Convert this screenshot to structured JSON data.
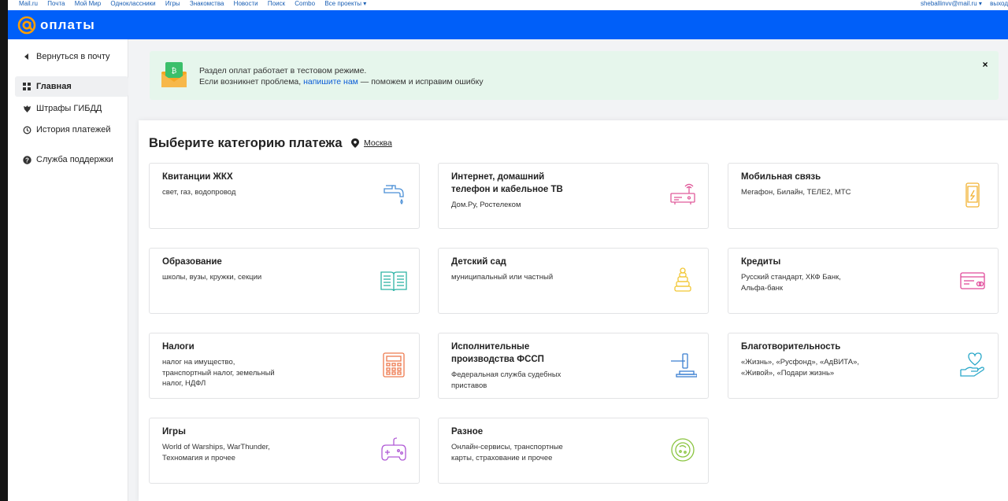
{
  "topbar": {
    "links": [
      "Mail.ru",
      "Почта",
      "Мой Мир",
      "Одноклассники",
      "Игры",
      "Знакомства",
      "Новости",
      "Поиск",
      "Combo",
      "Все проекты ▾"
    ],
    "user": "sheballinvv@mail.ru ▾",
    "logout": "выход"
  },
  "header": {
    "logo_text": "оплаты"
  },
  "sidebar": {
    "items": [
      {
        "label": "Вернуться в почту",
        "icon": "back-arrow-icon"
      },
      {
        "label": "Главная",
        "icon": "grid-icon"
      },
      {
        "label": "Штрафы ГИБДД",
        "icon": "emblem-icon"
      },
      {
        "label": "История платежей",
        "icon": "history-icon"
      },
      {
        "label": "Служба поддержки",
        "icon": "help-icon"
      }
    ]
  },
  "banner": {
    "line1": "Раздел оплат работает в тестовом режиме.",
    "line2_prefix": "Если возникнет проблема, ",
    "line2_link": "напишите нам",
    "line2_suffix": " — поможем и исправим ошибку",
    "close": "×"
  },
  "main": {
    "title": "Выберите категорию платежа",
    "city": "Москва"
  },
  "categories": [
    {
      "title": "Квитанции ЖКХ",
      "subtitle": "свет, газ, водопровод",
      "icon": "faucet-icon",
      "color": "#4a8fd6"
    },
    {
      "title": "Интернет, домашний телефон и кабельное ТВ",
      "subtitle": "Дом.Ру, Ростелеком",
      "icon": "router-icon",
      "color": "#e05a9a"
    },
    {
      "title": "Мобильная связь",
      "subtitle": "Мегафон, Билайн, ТЕЛЕ2, МТС",
      "icon": "phone-icon",
      "color": "#f2b233"
    },
    {
      "title": "Образование",
      "subtitle": "школы, вузы, кружки, секции",
      "icon": "book-icon",
      "color": "#2cb3a5"
    },
    {
      "title": "Детский сад",
      "subtitle": "муниципальный или частный",
      "icon": "pyramid-toy-icon",
      "color": "#f2c633"
    },
    {
      "title": "Кредиты",
      "subtitle": "Русский стандарт, ХКФ Банк, Альфа-банк",
      "icon": "card-icon",
      "color": "#e04a9a"
    },
    {
      "title": "Налоги",
      "subtitle": "налог на имущество, транспортный налог, земельный налог, НДФЛ",
      "icon": "calculator-icon",
      "color": "#ee7a4e"
    },
    {
      "title": "Исполнительные производства ФССП",
      "subtitle": "Федеральная служба судебных приставов",
      "icon": "gavel-icon",
      "color": "#3b7fd1"
    },
    {
      "title": "Благотворительность",
      "subtitle": "«Жизнь», «Русфонд», «АдВИТА», «Живой», «Подари жизнь»",
      "icon": "heart-hand-icon",
      "color": "#2aa8c9"
    },
    {
      "title": "Игры",
      "subtitle": "World of Warships, WarThunder, Техномагия и прочее",
      "icon": "gamepad-icon",
      "color": "#b05ad6"
    },
    {
      "title": "Разное",
      "subtitle": "Онлайн-сервисы, транспортные карты, страхование и прочее",
      "icon": "misc-icon",
      "color": "#8ac43f"
    }
  ]
}
